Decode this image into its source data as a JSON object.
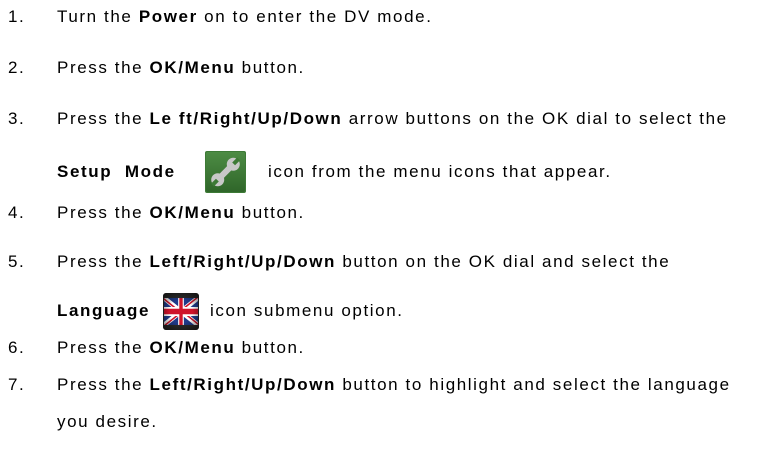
{
  "steps": [
    {
      "number": "1.",
      "pre": "Turn the ",
      "bold": "Power",
      "post": " on to enter the DV mode."
    },
    {
      "number": "2.",
      "pre": "Press the ",
      "bold": "OK/Menu",
      "post": " button."
    },
    {
      "number": "3.",
      "pre": "Press the ",
      "bold": "Le ft/Right/Up/Down",
      "post": " arrow buttons on the OK dial to select the",
      "cont_bold": "Setup  Mode",
      "cont_post": "icon from the menu icons that appear."
    },
    {
      "number": "4.",
      "pre": "Press the ",
      "bold": "OK/Menu",
      "post": " button."
    },
    {
      "number": "5.",
      "pre": "Press the ",
      "bold": "Left/Right/Up/Down",
      "post": " button on the OK dial and select the",
      "cont_bold": "Language",
      "cont_post": "icon submenu option."
    },
    {
      "number": "6.",
      "pre": "Press the ",
      "bold": "OK/Menu",
      "post": " button."
    },
    {
      "number": "7.",
      "pre": "Press the ",
      "bold": "Left/Right/Up/Down",
      "post": " button to highlight and select the language",
      "cont_post": "you desire."
    }
  ],
  "icons": {
    "setup_mode": "wrench-icon",
    "language": "uk-flag-icon"
  },
  "colors": {
    "setup_icon_bg": "#3d7a36",
    "setup_icon_wrench": "#c8c8c8",
    "flag_frame": "#2a2a2a",
    "flag_blue": "#1f3a8a",
    "flag_red": "#cf142b"
  }
}
